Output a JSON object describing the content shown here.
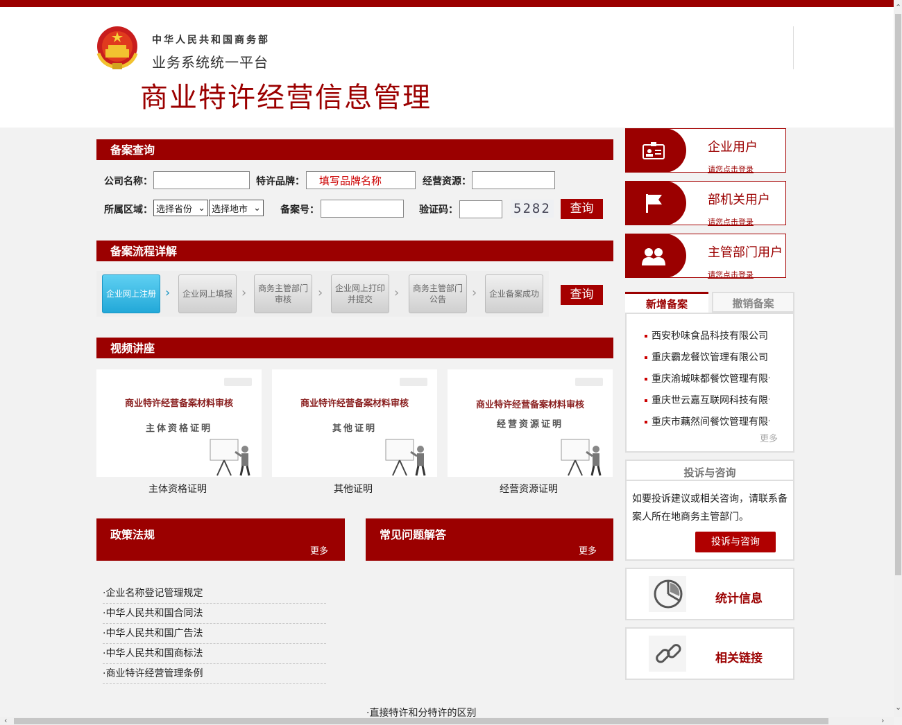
{
  "header": {
    "ministry": "中华人民共和国商务部",
    "platform": "业务系统统一平台",
    "app_title": "商业特许经营信息管理"
  },
  "search": {
    "section_title": "备案查询",
    "company_label": "公司名称：",
    "company_value": "",
    "brand_label": "特许品牌：",
    "brand_placeholder": "填写品牌名称",
    "resource_label": "经营资源：",
    "resource_value": "",
    "region_label": "所属区域：",
    "province_select": "选择省份",
    "city_select": "选择地市",
    "record_no_label": "备案号：",
    "record_no_value": "",
    "captcha_label": "验证码：",
    "captcha_value": "",
    "captcha_image": "5282",
    "query_button": "查询"
  },
  "process": {
    "section_title": "备案流程详解",
    "steps": [
      {
        "line1": "企业网上注册",
        "line2": ""
      },
      {
        "line1": "企业网上填报",
        "line2": ""
      },
      {
        "line1": "商务主管部门",
        "line2": "审核"
      },
      {
        "line1": "企业网上打印",
        "line2": "并提交"
      },
      {
        "line1": "商务主管部门",
        "line2": "公告"
      },
      {
        "line1": "企业备案成功",
        "line2": ""
      }
    ],
    "query_button": "查询"
  },
  "videos": {
    "section_title": "视频讲座",
    "items": [
      {
        "title": "商业特许经营备案材料审核",
        "subtitle": "主体资格证明",
        "caption": "主体资格证明"
      },
      {
        "title": "商业特许经营备案材料审核",
        "subtitle": "其他证明",
        "caption": "其他证明"
      },
      {
        "title": "商业特许经营备案材料审核",
        "subtitle": "经营资源证明",
        "caption": "经营资源证明"
      }
    ]
  },
  "policies": {
    "title": "政策法规",
    "more": "更多",
    "items": [
      "·企业名称登记管理规定",
      "·中华人民共和国合同法",
      "·中华人民共和国广告法",
      "·中华人民共和国商标法",
      "·商业特许经营管理条例"
    ]
  },
  "faq": {
    "title": "常见问题解答",
    "more": "更多",
    "items": [
      "·直接特许和分特许的区别"
    ]
  },
  "users": [
    {
      "title": "企业用户",
      "sub": "请您点击登录",
      "icon": "id-card-icon"
    },
    {
      "title": "部机关用户",
      "sub": "请您点击登录",
      "icon": "flag-icon"
    },
    {
      "title": "主管部门用户",
      "sub": "请您点击登录",
      "icon": "users-icon"
    }
  ],
  "records": {
    "tabs": [
      "新增备案",
      "撤销备案"
    ],
    "items": [
      "西安秒味食品科技有限公司",
      "重庆霸龙餐饮管理有限公司",
      "重庆渝城味都餐饮管理有限公司",
      "重庆世云嘉互联网科技有限公司",
      "重庆市藕然间餐饮管理有限公司"
    ],
    "more": "更多"
  },
  "complaint": {
    "title": "投诉与咨询",
    "text": "如要投诉建议或相关咨询，请联系备案人所在地商务主管部门。",
    "button": "投诉与咨询"
  },
  "stats": {
    "label": "统计信息",
    "icon": "pie-chart-icon"
  },
  "links": {
    "label": "相关链接",
    "icon": "chain-link-icon"
  },
  "colors": {
    "brand": "#9b0000",
    "accent": "#a50000",
    "step_active": "#22a8d8"
  }
}
